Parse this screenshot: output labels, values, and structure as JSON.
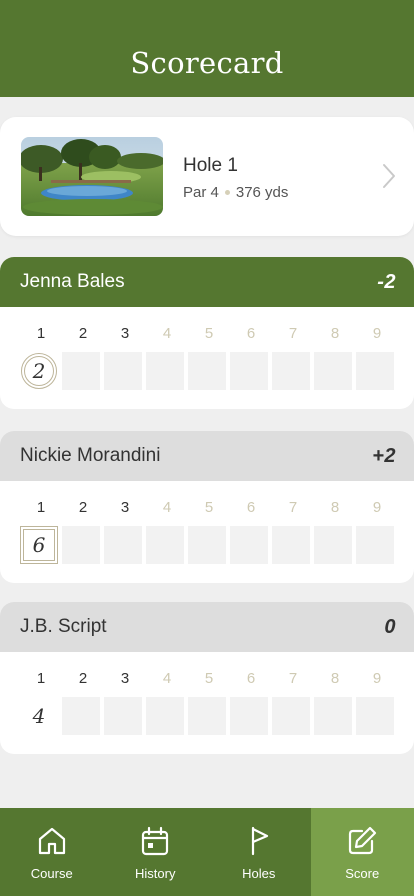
{
  "header": {
    "title": "Scorecard"
  },
  "hole": {
    "name": "Hole 1",
    "par": "Par 4",
    "distance": "376 yds"
  },
  "hole_numbers": [
    "1",
    "2",
    "3",
    "4",
    "5",
    "6",
    "7",
    "8",
    "9"
  ],
  "players": [
    {
      "name": "Jenna Bales",
      "relative": "-2",
      "scores": [
        "2",
        "",
        "",
        "",
        "",
        "",
        "",
        "",
        ""
      ],
      "mark": "circle"
    },
    {
      "name": "Nickie Morandini",
      "relative": "+2",
      "scores": [
        "6",
        "",
        "",
        "",
        "",
        "",
        "",
        "",
        ""
      ],
      "mark": "square"
    },
    {
      "name": "J.B. Script",
      "relative": "0",
      "scores": [
        "4",
        "",
        "",
        "",
        "",
        "",
        "",
        "",
        ""
      ],
      "mark": "none"
    }
  ],
  "tabs": [
    {
      "label": "Course",
      "icon": "home-icon"
    },
    {
      "label": "History",
      "icon": "calendar-icon"
    },
    {
      "label": "Holes",
      "icon": "flag-icon"
    },
    {
      "label": "Score",
      "icon": "edit-icon"
    }
  ],
  "colors": {
    "brand": "#557730",
    "active_tab": "#7aa04a",
    "muted": "#cfcab3",
    "mark": "#bdb59a"
  }
}
